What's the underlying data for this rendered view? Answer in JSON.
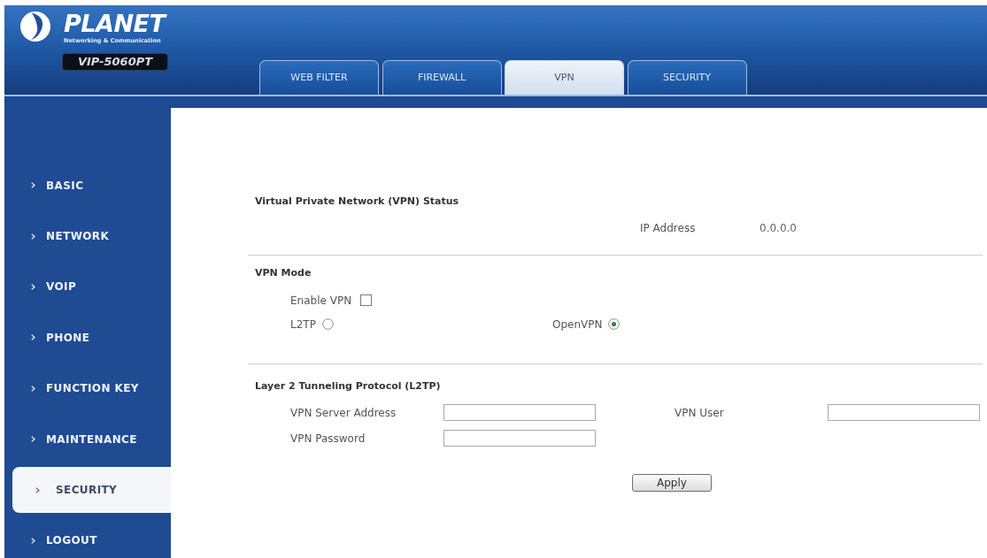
{
  "header": {
    "logo": {
      "brand": "PLANET",
      "tagline": "Networking & Communication"
    },
    "model": "VIP-5060PT"
  },
  "tabs": [
    {
      "label": "WEB FILTER",
      "selected": false
    },
    {
      "label": "FIREWALL",
      "selected": false
    },
    {
      "label": "VPN",
      "selected": true
    },
    {
      "label": "SECURITY",
      "selected": false
    }
  ],
  "sidebar": {
    "items": [
      {
        "label": "BASIC",
        "selected": false
      },
      {
        "label": "NETWORK",
        "selected": false
      },
      {
        "label": "VOIP",
        "selected": false
      },
      {
        "label": "PHONE",
        "selected": false
      },
      {
        "label": "FUNCTION KEY",
        "selected": false
      },
      {
        "label": "MAINTENANCE",
        "selected": false
      },
      {
        "label": "SECURITY",
        "selected": true
      },
      {
        "label": "LOGOUT",
        "selected": false
      }
    ]
  },
  "vpn_status": {
    "title": "Virtual Private Network (VPN) Status",
    "ip_address": {
      "label": "IP Address",
      "value": "0.0.0.0"
    }
  },
  "vpn_mode": {
    "title": "VPN Mode",
    "enable_vpn": {
      "label": "Enable VPN",
      "checked": false
    },
    "modes": [
      {
        "label": "L2TP",
        "selected": false
      },
      {
        "label": "OpenVPN",
        "selected": true
      }
    ]
  },
  "l2tp": {
    "title": "Layer 2 Tunneling Protocol (L2TP)",
    "fields": [
      {
        "label": "VPN Server Address"
      },
      {
        "label": "VPN User"
      },
      {
        "label": "VPN Password"
      }
    ]
  },
  "apply_button": "Apply"
}
